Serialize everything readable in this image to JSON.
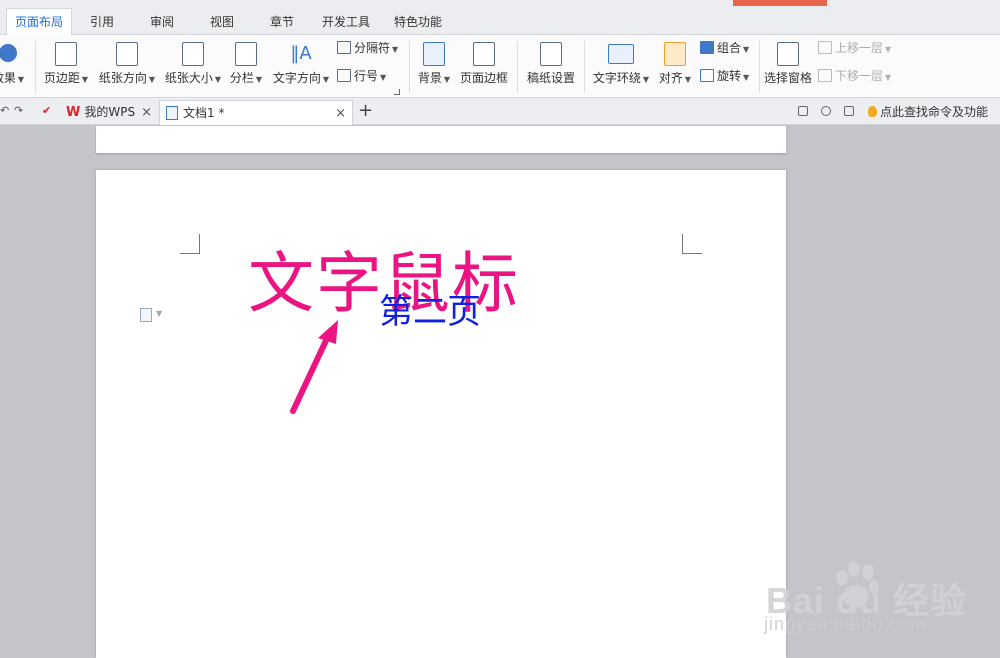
{
  "menu": {
    "tabs": [
      {
        "label": "页面布局",
        "active": true
      },
      {
        "label": "引用"
      },
      {
        "label": "审阅"
      },
      {
        "label": "视图"
      },
      {
        "label": "章节"
      },
      {
        "label": "开发工具"
      },
      {
        "label": "特色功能"
      }
    ]
  },
  "ribbon": {
    "effects": "效果",
    "margins": "页边距",
    "orientation": "纸张方向",
    "size": "纸张大小",
    "columns": "分栏",
    "text_direction": "文字方向",
    "separator": "分隔符",
    "line_number": "行号",
    "background": "背景",
    "page_border": "页面边框",
    "manuscript": "稿纸设置",
    "text_wrap": "文字环绕",
    "align": "对齐",
    "group": "组合",
    "rotate": "旋转",
    "selection_pane": "选择窗格",
    "bring_forward": "上移一层",
    "send_backward": "下移一层"
  },
  "docbar": {
    "tabs": [
      {
        "label": "我的WPS"
      },
      {
        "label": "文档1 *",
        "active": true
      }
    ],
    "find_command": "点此查找命令及功能"
  },
  "document": {
    "art_text": "文字鼠标",
    "page_text": "第二页"
  },
  "watermark": {
    "brand": "Bai du 经验",
    "url": "jingyan.baidu.com"
  },
  "colors": {
    "accent": "#1f6fd1",
    "art_text": "#ec1483",
    "page_text": "#1020e0",
    "orange": "#e8644a"
  }
}
